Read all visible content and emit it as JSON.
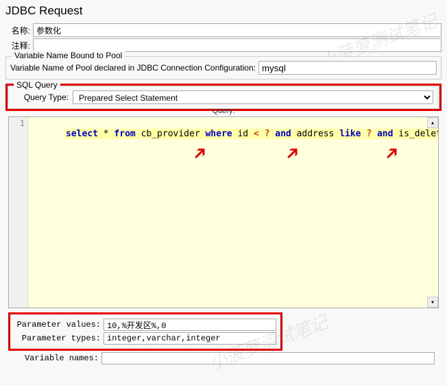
{
  "title": "JDBC Request",
  "name_label": "名称:",
  "name_value": "参数化",
  "comment_label": "注释:",
  "comment_value": "",
  "pool_section": {
    "legend": "Variable Name Bound to Pool",
    "label": "Variable Name of Pool declared in JDBC Connection Configuration:",
    "value": "mysql"
  },
  "sql_query": {
    "legend": "SQL Query",
    "query_type_label": "Query Type:",
    "query_type_value": "Prepared Select Statement",
    "query_label": "Query:",
    "line_number": "1",
    "code": {
      "select": "select",
      "star": "*",
      "from": "from",
      "table": "cb_provider",
      "where": "where",
      "col1": "id",
      "op1": "< ?",
      "and1": "and",
      "col2": "address",
      "like": "like",
      "q2": "?",
      "and2": "and",
      "col3": "is_delete",
      "op3": "= ?"
    }
  },
  "params": {
    "values_label": "Parameter values:",
    "values": "10,%开发区%,0",
    "types_label": "Parameter types:",
    "types": "integer,varchar,integer"
  },
  "var_names": {
    "label": "Variable names:",
    "value": ""
  },
  "watermark": "小菠萝测试笔记"
}
